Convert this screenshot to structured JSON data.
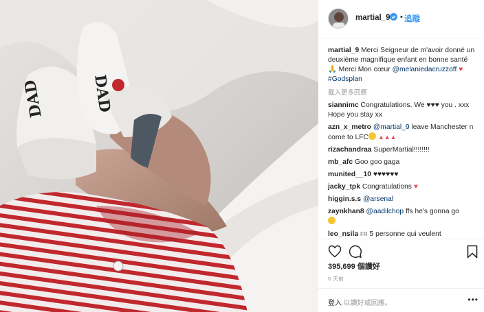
{
  "post": {
    "username": "martial_9",
    "separator": "•",
    "follow_label": "追蹤"
  },
  "caption": {
    "username": "martial_9",
    "text": "Merci Seigneur de m'avoir donné un deuxième magnifique enfant en bonne santé 🙏 Merci Mon cœur",
    "mention": "@melaniedacruzzoff",
    "hashtag": "#Godsplan"
  },
  "load_more_label": "載入更多回應",
  "comments": [
    {
      "user": "siannimc",
      "text": "Congratulations. We ♥♥♥ you . xxx Hope you stay xx"
    },
    {
      "user": "azn_x_metro",
      "mention": "@martial_9",
      "text": "leave Manchester n come to LFC"
    },
    {
      "user": "rizachandraa",
      "text": "SuperMartial!!!!!!!!"
    },
    {
      "user": "mb_afc",
      "text": "Goo goo gaga"
    },
    {
      "user": "munited__10",
      "text": "♥♥♥♥♥♥"
    },
    {
      "user": "jacky_tpk",
      "text": "Congratulations"
    },
    {
      "user": "higgin.s.s",
      "mention": "@arsenal",
      "text": ""
    },
    {
      "user": "zaynkhan8",
      "mention": "@aadilchop",
      "text": "ffs he's gonna go"
    },
    {
      "user": "leo_nsila",
      "tag": "FR",
      "text": "5 personne qui veulent"
    }
  ],
  "likes": {
    "count": "395,699",
    "label": "個讚好"
  },
  "age": "6 天前",
  "add_comment": {
    "login": "登入",
    "rest": "以讚好或回應。"
  },
  "more_options": "•••",
  "colors": {
    "link": "#003569",
    "follow": "#3897f0",
    "heart": "#ed4956"
  },
  "icons": [
    "verified-badge-icon",
    "heart-icon",
    "comment-icon",
    "bookmark-icon",
    "more-options-icon"
  ]
}
